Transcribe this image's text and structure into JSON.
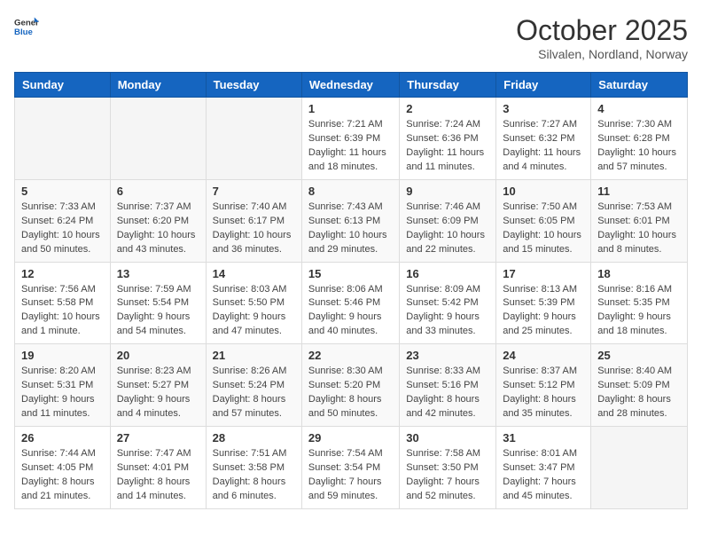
{
  "header": {
    "logo_general": "General",
    "logo_blue": "Blue",
    "month": "October 2025",
    "location": "Silvalen, Nordland, Norway"
  },
  "days_of_week": [
    "Sunday",
    "Monday",
    "Tuesday",
    "Wednesday",
    "Thursday",
    "Friday",
    "Saturday"
  ],
  "weeks": [
    [
      {
        "day": "",
        "info": ""
      },
      {
        "day": "",
        "info": ""
      },
      {
        "day": "",
        "info": ""
      },
      {
        "day": "1",
        "info": "Sunrise: 7:21 AM\nSunset: 6:39 PM\nDaylight: 11 hours\nand 18 minutes."
      },
      {
        "day": "2",
        "info": "Sunrise: 7:24 AM\nSunset: 6:36 PM\nDaylight: 11 hours\nand 11 minutes."
      },
      {
        "day": "3",
        "info": "Sunrise: 7:27 AM\nSunset: 6:32 PM\nDaylight: 11 hours\nand 4 minutes."
      },
      {
        "day": "4",
        "info": "Sunrise: 7:30 AM\nSunset: 6:28 PM\nDaylight: 10 hours\nand 57 minutes."
      }
    ],
    [
      {
        "day": "5",
        "info": "Sunrise: 7:33 AM\nSunset: 6:24 PM\nDaylight: 10 hours\nand 50 minutes."
      },
      {
        "day": "6",
        "info": "Sunrise: 7:37 AM\nSunset: 6:20 PM\nDaylight: 10 hours\nand 43 minutes."
      },
      {
        "day": "7",
        "info": "Sunrise: 7:40 AM\nSunset: 6:17 PM\nDaylight: 10 hours\nand 36 minutes."
      },
      {
        "day": "8",
        "info": "Sunrise: 7:43 AM\nSunset: 6:13 PM\nDaylight: 10 hours\nand 29 minutes."
      },
      {
        "day": "9",
        "info": "Sunrise: 7:46 AM\nSunset: 6:09 PM\nDaylight: 10 hours\nand 22 minutes."
      },
      {
        "day": "10",
        "info": "Sunrise: 7:50 AM\nSunset: 6:05 PM\nDaylight: 10 hours\nand 15 minutes."
      },
      {
        "day": "11",
        "info": "Sunrise: 7:53 AM\nSunset: 6:01 PM\nDaylight: 10 hours\nand 8 minutes."
      }
    ],
    [
      {
        "day": "12",
        "info": "Sunrise: 7:56 AM\nSunset: 5:58 PM\nDaylight: 10 hours\nand 1 minute."
      },
      {
        "day": "13",
        "info": "Sunrise: 7:59 AM\nSunset: 5:54 PM\nDaylight: 9 hours\nand 54 minutes."
      },
      {
        "day": "14",
        "info": "Sunrise: 8:03 AM\nSunset: 5:50 PM\nDaylight: 9 hours\nand 47 minutes."
      },
      {
        "day": "15",
        "info": "Sunrise: 8:06 AM\nSunset: 5:46 PM\nDaylight: 9 hours\nand 40 minutes."
      },
      {
        "day": "16",
        "info": "Sunrise: 8:09 AM\nSunset: 5:42 PM\nDaylight: 9 hours\nand 33 minutes."
      },
      {
        "day": "17",
        "info": "Sunrise: 8:13 AM\nSunset: 5:39 PM\nDaylight: 9 hours\nand 25 minutes."
      },
      {
        "day": "18",
        "info": "Sunrise: 8:16 AM\nSunset: 5:35 PM\nDaylight: 9 hours\nand 18 minutes."
      }
    ],
    [
      {
        "day": "19",
        "info": "Sunrise: 8:20 AM\nSunset: 5:31 PM\nDaylight: 9 hours\nand 11 minutes."
      },
      {
        "day": "20",
        "info": "Sunrise: 8:23 AM\nSunset: 5:27 PM\nDaylight: 9 hours\nand 4 minutes."
      },
      {
        "day": "21",
        "info": "Sunrise: 8:26 AM\nSunset: 5:24 PM\nDaylight: 8 hours\nand 57 minutes."
      },
      {
        "day": "22",
        "info": "Sunrise: 8:30 AM\nSunset: 5:20 PM\nDaylight: 8 hours\nand 50 minutes."
      },
      {
        "day": "23",
        "info": "Sunrise: 8:33 AM\nSunset: 5:16 PM\nDaylight: 8 hours\nand 42 minutes."
      },
      {
        "day": "24",
        "info": "Sunrise: 8:37 AM\nSunset: 5:12 PM\nDaylight: 8 hours\nand 35 minutes."
      },
      {
        "day": "25",
        "info": "Sunrise: 8:40 AM\nSunset: 5:09 PM\nDaylight: 8 hours\nand 28 minutes."
      }
    ],
    [
      {
        "day": "26",
        "info": "Sunrise: 7:44 AM\nSunset: 4:05 PM\nDaylight: 8 hours\nand 21 minutes."
      },
      {
        "day": "27",
        "info": "Sunrise: 7:47 AM\nSunset: 4:01 PM\nDaylight: 8 hours\nand 14 minutes."
      },
      {
        "day": "28",
        "info": "Sunrise: 7:51 AM\nSunset: 3:58 PM\nDaylight: 8 hours\nand 6 minutes."
      },
      {
        "day": "29",
        "info": "Sunrise: 7:54 AM\nSunset: 3:54 PM\nDaylight: 7 hours\nand 59 minutes."
      },
      {
        "day": "30",
        "info": "Sunrise: 7:58 AM\nSunset: 3:50 PM\nDaylight: 7 hours\nand 52 minutes."
      },
      {
        "day": "31",
        "info": "Sunrise: 8:01 AM\nSunset: 3:47 PM\nDaylight: 7 hours\nand 45 minutes."
      },
      {
        "day": "",
        "info": ""
      }
    ]
  ]
}
